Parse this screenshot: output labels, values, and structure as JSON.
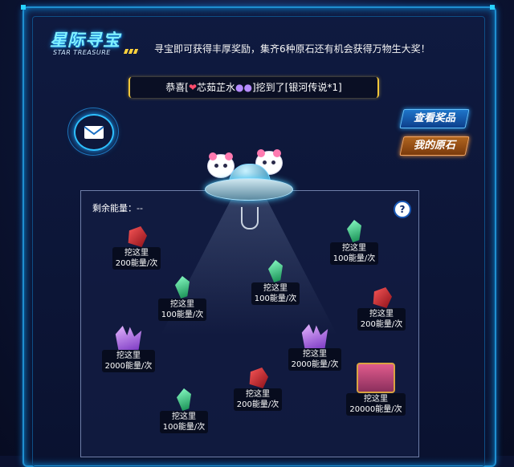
{
  "game": {
    "logo_title": "星际寻宝",
    "logo_subtitle": "STAR TREASURE",
    "intro_text": "寻宝即可获得丰厚奖励，集齐6种原石还有机会获得万物生大奖！",
    "congrats": {
      "prefix": "恭喜[",
      "user_name": "芯茹芷水",
      "middle": "]挖到了[",
      "prize": "银河传说*1",
      "suffix": "]"
    },
    "buttons": {
      "view_prizes": "查看奖品",
      "my_stones": "我的原石"
    },
    "energy_label": "剩余能量：--",
    "help_label": "?",
    "dig_spots": [
      {
        "id": "red-top-left",
        "gem": "red",
        "label": "挖这里",
        "cost": "200能量/次"
      },
      {
        "id": "green-top-right",
        "gem": "green",
        "label": "挖这里",
        "cost": "100能量/次"
      },
      {
        "id": "green-center",
        "gem": "green",
        "label": "挖这里",
        "cost": "100能量/次"
      },
      {
        "id": "green-left",
        "gem": "green",
        "label": "挖这里",
        "cost": "100能量/次"
      },
      {
        "id": "red-right",
        "gem": "red",
        "label": "挖这里",
        "cost": "200能量/次"
      },
      {
        "id": "purple-left",
        "gem": "purple",
        "label": "挖这里",
        "cost": "2000能量/次"
      },
      {
        "id": "purple-center",
        "gem": "purple",
        "label": "挖这里",
        "cost": "2000能量/次"
      },
      {
        "id": "red-bottom",
        "gem": "red",
        "label": "挖这里",
        "cost": "200能量/次"
      },
      {
        "id": "chest",
        "gem": "chest",
        "label": "挖这里",
        "cost": "20000能量/次"
      },
      {
        "id": "green-bottom",
        "gem": "green",
        "label": "挖这里",
        "cost": "100能量/次"
      }
    ]
  },
  "colors": {
    "frame": "#1f8fd0",
    "accent_gold": "#f2c63a",
    "prize_button": "#1e75c9",
    "stones_button": "#b0651f"
  }
}
